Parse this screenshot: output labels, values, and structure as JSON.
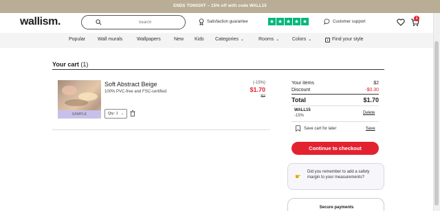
{
  "promo": {
    "text": "ENDS TONIGHT – 15% off with code WALL15"
  },
  "header": {
    "logo": "wallism.",
    "search_placeholder": "Search",
    "satisfaction": "Satisfaction guarantee",
    "rating_stars": 5,
    "support": "Customer support",
    "cart_count": "1"
  },
  "nav": {
    "items": [
      "Popular",
      "Wall murals",
      "Wallpapers",
      "New",
      "Kids",
      "Categories",
      "Rooms",
      "Colors",
      "Find your style"
    ]
  },
  "cart": {
    "title": "Your cart",
    "count": "(1)",
    "item": {
      "name": "Soft Abstract Beige",
      "subtitle": "100% PVC-free and FSC-certified",
      "badge": "SAMPLE",
      "qty_label": "Qty: 1",
      "discount_pct": "(-15%)",
      "price": "$1.70",
      "old_price": "$2"
    }
  },
  "summary": {
    "items_label": "Your items",
    "items_value": "$2",
    "discount_label": "Discount",
    "discount_value": "-$0.30",
    "total_label": "Total",
    "total_value": "$1.70",
    "code": "WALL15",
    "code_pct": "-15%",
    "delete_label": "Delete",
    "save_label": "Save cart for later",
    "save_link": "Save",
    "checkout_label": "Continue to checkout",
    "tip_text": "Did you remember to add a safety margin to your measurements?",
    "secure_title": "Secure payments"
  },
  "colors": {
    "accent": "#e32230",
    "promo_bg": "#b9ad95",
    "trustpilot": "#00b67a",
    "sample_bg": "#c8c0ea"
  }
}
